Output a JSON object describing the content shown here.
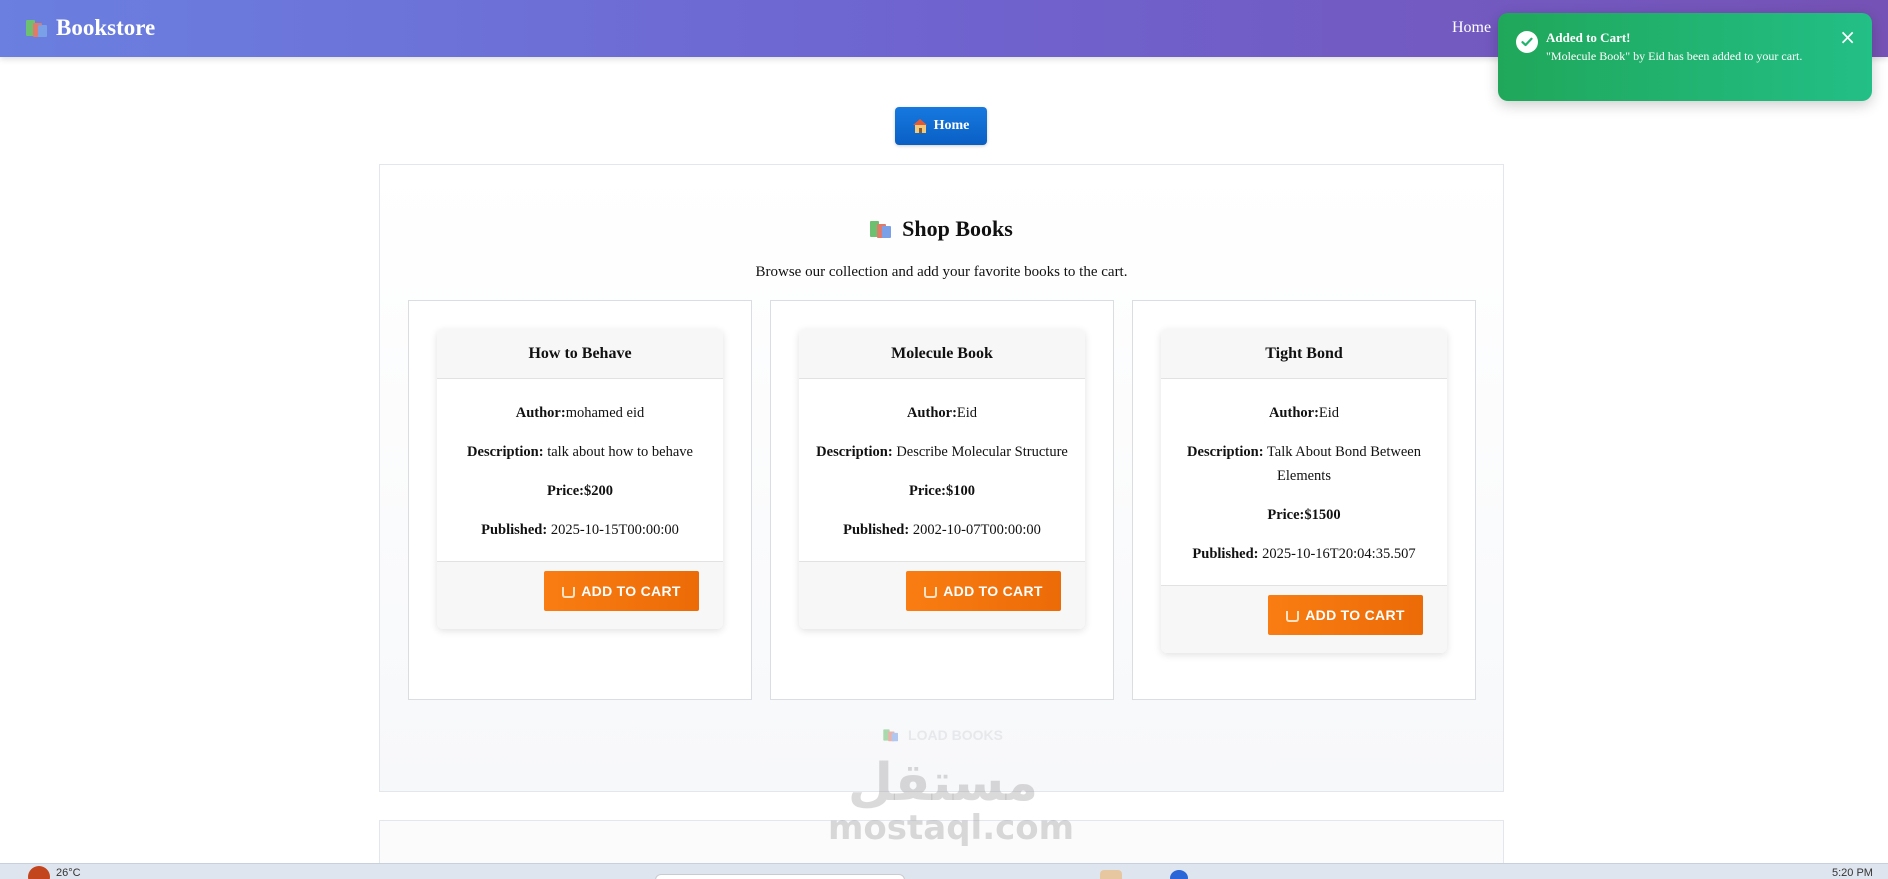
{
  "navbar": {
    "brand": "Bookstore",
    "links": [
      "Home"
    ]
  },
  "toast": {
    "title": "Added to Cart!",
    "message": "\"Molecule Book\" by Eid has been added to your cart.",
    "close": "×",
    "color": "#22b46f"
  },
  "home_button": {
    "label": "Home"
  },
  "shop": {
    "title": "Shop Books",
    "subtitle": "Browse our collection and add your favorite books to the cart."
  },
  "labels": {
    "author": "Author:",
    "description": "Description:",
    "price": "Price:",
    "published": "Published:",
    "add_to_cart": "ADD TO CART"
  },
  "books": [
    {
      "title": "How to Behave",
      "author": "mohamed eid",
      "description": "talk about how to behave",
      "price": "$200",
      "published": "2025-10-15T00:00:00"
    },
    {
      "title": "Molecule Book",
      "author": "Eid",
      "description": "Describe Molecular Structure",
      "price": "$100",
      "published": "2002-10-07T00:00:00"
    },
    {
      "title": "Tight Bond",
      "author": "Eid",
      "description": "Talk About Bond Between Elements",
      "price": "$1500",
      "published": "2025-10-16T20:04:35.507"
    }
  ],
  "load_books": {
    "label": "LOAD BOOKS"
  },
  "watermark": {
    "arabic": "مستقل",
    "latin": "mostaql.com"
  },
  "taskbar": {
    "temperature": "26°C",
    "time": "5:20 PM"
  },
  "colors": {
    "accent": "#0a6ad6",
    "cart": "#f57510",
    "navbar": "#6f63cf",
    "toast": "#22b46f"
  }
}
